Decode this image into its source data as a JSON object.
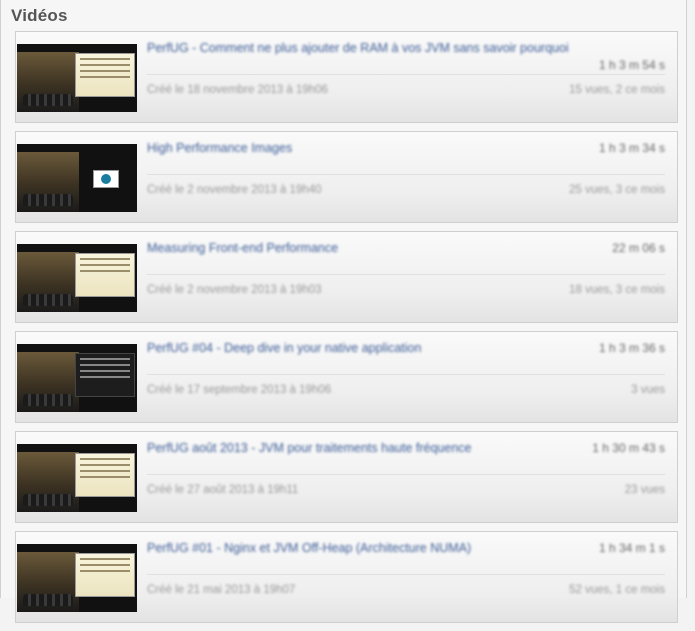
{
  "panel": {
    "title": "Vidéos"
  },
  "videos": [
    {
      "title": "PerfUG - Comment ne plus ajouter de RAM à vos JVM sans savoir pourquoi",
      "duration": "1 h 3 m 54 s",
      "created": "Créé le 18 novembre 2013 à 19h06",
      "views": "15 vues, 2 ce mois",
      "thumb": "slides-light"
    },
    {
      "title": "High Performance Images",
      "duration": "1 h 3 m 34 s",
      "created": "Créé le 2 novembre 2013 à 19h40",
      "views": "25 vues, 3 ce mois",
      "thumb": "globe"
    },
    {
      "title": "Measuring Front-end Performance",
      "duration": "22 m 06 s",
      "created": "Créé le 2 novembre 2013 à 19h03",
      "views": "18 vues, 3 ce mois",
      "thumb": "slides-light"
    },
    {
      "title": "PerfUG #04 - Deep dive in your native application",
      "duration": "1 h 3 m 36 s",
      "created": "Créé le 17 septembre 2013 à 19h06",
      "views": "3 vues",
      "thumb": "slides-dark"
    },
    {
      "title": "PerfUG août 2013 - JVM pour traitements haute fréquence",
      "duration": "1 h 30 m 43 s",
      "created": "Créé le 27 août 2013 à 19h11",
      "views": "23 vues",
      "thumb": "slides-light"
    },
    {
      "title": "PerfUG #01 - Nginx et JVM Off-Heap (Architecture NUMA)",
      "duration": "1 h 34 m 1 s",
      "created": "Créé le 21 mai 2013 à 19h07",
      "views": "52 vues, 1 ce mois",
      "thumb": "slides-light"
    }
  ]
}
